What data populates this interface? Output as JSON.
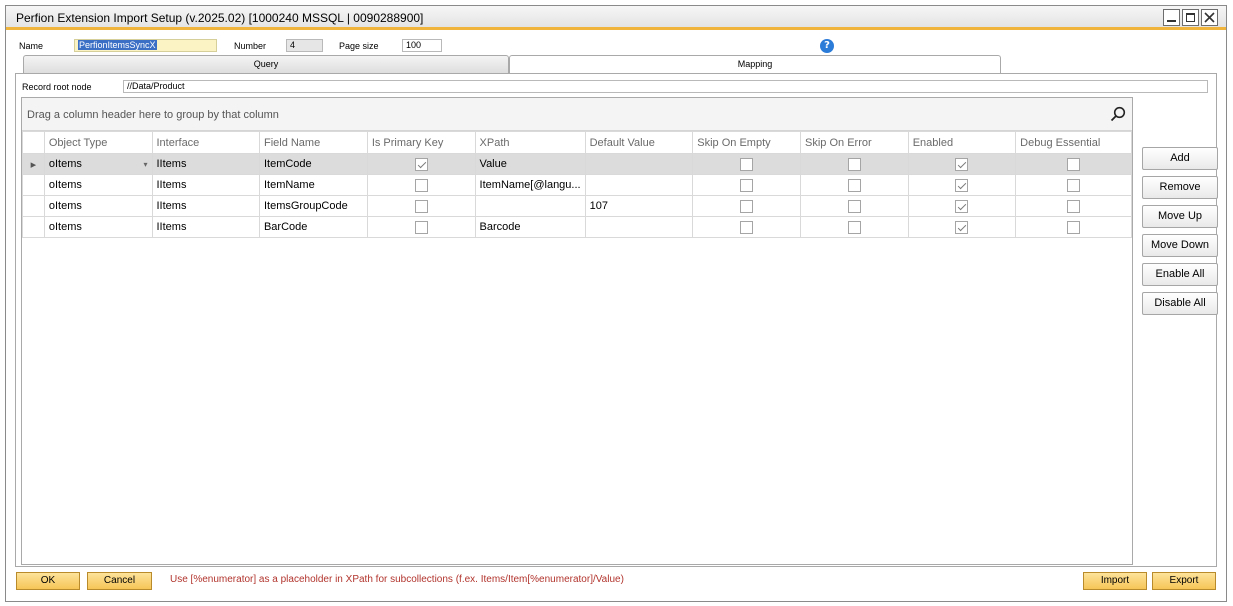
{
  "window": {
    "title": "Perfion Extension Import Setup (v.2025.02) [1000240 MSSQL | 0090288900]"
  },
  "header": {
    "name_label": "Name",
    "name_value": "PerfionItemsSyncX",
    "number_label": "Number",
    "number_value": "4",
    "pagesize_label": "Page size",
    "pagesize_value": "100",
    "help_symbol": "?"
  },
  "tabs": [
    {
      "label": "Query"
    },
    {
      "label": "Mapping"
    }
  ],
  "mapping": {
    "root_label": "Record root node",
    "root_value": "//Data/Product",
    "group_hint": "Drag a column header here to group by that column",
    "columns": [
      "Object Type",
      "Interface",
      "Field Name",
      "Is Primary Key",
      "XPath",
      "Default Value",
      "Skip On Empty",
      "Skip On Error",
      "Enabled",
      "Debug Essential"
    ],
    "rows": [
      {
        "object_type": "oItems",
        "interface": "IItems",
        "field_name": "ItemCode",
        "is_primary_key": true,
        "xpath": "Value",
        "default_value": "",
        "skip_on_empty": false,
        "skip_on_error": false,
        "enabled": true,
        "debug_essential": false
      },
      {
        "object_type": "oItems",
        "interface": "IItems",
        "field_name": "ItemName",
        "is_primary_key": false,
        "xpath": "ItemName[@langu...",
        "default_value": "",
        "skip_on_empty": false,
        "skip_on_error": false,
        "enabled": true,
        "debug_essential": false
      },
      {
        "object_type": "oItems",
        "interface": "IItems",
        "field_name": "ItemsGroupCode",
        "is_primary_key": false,
        "xpath": "",
        "default_value": "107",
        "skip_on_empty": false,
        "skip_on_error": false,
        "enabled": true,
        "debug_essential": false
      },
      {
        "object_type": "oItems",
        "interface": "IItems",
        "field_name": "BarCode",
        "is_primary_key": false,
        "xpath": "Barcode",
        "default_value": "",
        "skip_on_empty": false,
        "skip_on_error": false,
        "enabled": true,
        "debug_essential": false
      }
    ]
  },
  "side_buttons": {
    "add": "Add",
    "remove": "Remove",
    "move_up": "Move Up",
    "move_down": "Move Down",
    "enable_all": "Enable All",
    "disable_all": "Disable All"
  },
  "footer": {
    "ok": "OK",
    "cancel": "Cancel",
    "note": "Use [%enumerator] as a placeholder in XPath for subcollections (f.ex. Items/Item[%enumerator]/Value)",
    "import": "Import",
    "export": "Export"
  },
  "colors": {
    "accent_orange": "#f0b43c",
    "button_orange": "#f6c557",
    "note_red": "#b2342d",
    "help_blue": "#2b7bd8",
    "selection_blue": "#3b6fc5"
  }
}
